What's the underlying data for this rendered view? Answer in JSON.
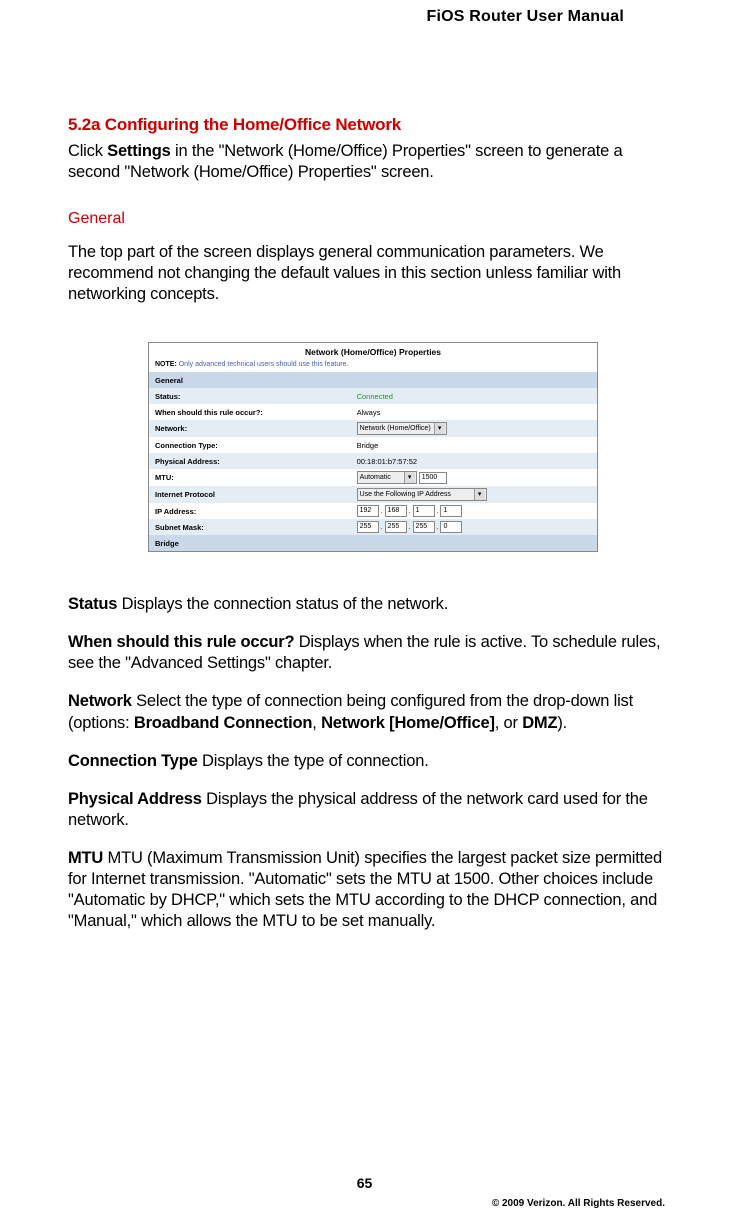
{
  "header": {
    "title": "FiOS Router User Manual"
  },
  "section": {
    "number_title": "5.2a  Configuring the Home/Office Network",
    "intro_prefix": "Click ",
    "intro_bold": "Settings",
    "intro_suffix": " in the \"Network (Home/Office) Properties\" screen to generate a second \"Network (Home/Office) Properties\" screen.",
    "sub_heading": "General",
    "general_para": "The top part of the screen displays general communication parameters. We recommend not changing the default values in this section unless familiar with networking concepts."
  },
  "figure": {
    "title": "Network (Home/Office) Properties",
    "note_label": "NOTE:",
    "note_text": "Only advanced technical users should use this feature.",
    "rows": {
      "section_general": "General",
      "status_label": "Status:",
      "status_value": "Connected",
      "when_label": "When should this rule occur?:",
      "when_value": "Always",
      "network_label": "Network:",
      "network_value": "Network (Home/Office)",
      "conn_label": "Connection Type:",
      "conn_value": "Bridge",
      "phys_label": "Physical Address:",
      "phys_value": "00:18:01:b7:57:52",
      "mtu_label": "MTU:",
      "mtu_select": "Automatic",
      "mtu_num": "1500",
      "ip_proto_label": "Internet Protocol",
      "ip_proto_value": "Use the Following IP Address",
      "ip_addr_label": "IP Address:",
      "ip1": "192",
      "ip2": "168",
      "ip3": "1",
      "ip4": "1",
      "subnet_label": "Subnet Mask:",
      "sm1": "255",
      "sm2": "255",
      "sm3": "255",
      "sm4": "0",
      "section_bridge": "Bridge"
    }
  },
  "defs": {
    "status_b": "Status",
    "status_t": "  Displays the connection status of the network.",
    "when_b": "When should this rule occur?",
    "when_t": "  Displays when the rule is active. To schedule rules, see the \"Advanced Settings\" chapter.",
    "network_b": "Network",
    "network_t_pre": "  Select the type of connection being configured from the drop-down list (options: ",
    "network_opt1": "Broadband Connection",
    "network_sep1": ", ",
    "network_opt2": "Network [Home/Office]",
    "network_sep2": ", or ",
    "network_opt3": "DMZ",
    "network_t_post": ").",
    "conn_b": "Connection Type",
    "conn_t": "  Displays the type of connection.",
    "phys_b": "Physical Address",
    "phys_t": "  Displays the physical address of the network card used for the network.",
    "mtu_b": "MTU",
    "mtu_t": "  MTU (Maximum Transmission Unit) specifies the largest packet size permitted for Internet transmission. \"Automatic\" sets the MTU at 1500. Other choices include \"Automatic by DHCP,\" which sets the MTU according to the DHCP connection, and \"Manual,\" which allows the MTU to be set manually."
  },
  "footer": {
    "page": "65",
    "copyright": "© 2009 Verizon. All Rights Reserved."
  }
}
